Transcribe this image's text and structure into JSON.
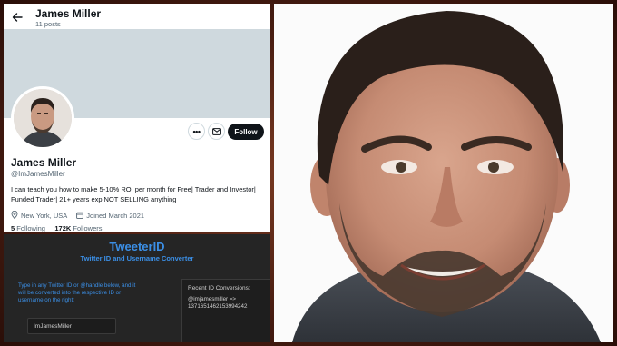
{
  "twitter": {
    "header_name": "James Miller",
    "posts_count": "11 posts",
    "display_name": "James Miller",
    "handle": "@ImJamesMiller",
    "bio": "I can teach you how to make 5-10% ROI per month for Free| Trader and Investor| Funded Trader| 21+ years exp|NOT SELLING anything",
    "location": "New York, USA",
    "joined": "Joined March 2021",
    "following_count": "5",
    "following_label": "Following",
    "followers_count": "172K",
    "followers_label": "Followers",
    "more_label": "•••",
    "follow_label": "Follow",
    "icons": {
      "back": "back-arrow-icon",
      "message": "envelope-icon",
      "location": "location-pin-icon",
      "calendar": "calendar-icon"
    }
  },
  "tweeterid": {
    "title": "TweeterID",
    "subtitle": "Twitter ID and Username Converter",
    "instructions": "Type in any Twitter ID or @handle below, and it will be converted into the respective ID or username on the right:",
    "input_value": "ImJamesMiller",
    "recent_title": "Recent ID Conversions:",
    "recent_entry": "@imjamesmiller => 1371651462153994242"
  },
  "colors": {
    "accent_blue": "#3b8fe6",
    "follow_button": "#0f1419",
    "banner": "#cfd9de",
    "frame": "#4a1e12"
  }
}
